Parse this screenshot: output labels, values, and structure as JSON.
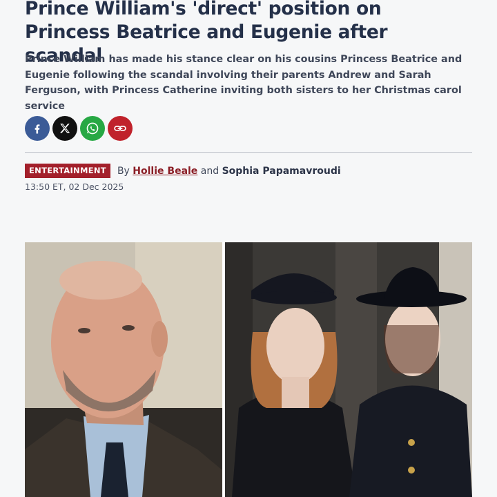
{
  "article": {
    "headline": "Prince William's 'direct' position on Princess Beatrice and Eugenie after scandal",
    "standfirst": "Prince William has made his stance clear on his cousins Princess Beatrice and Eugenie following the scandal involving their parents Andrew and Sarah Ferguson, with Princess Catherine inviting both sisters to her Christmas carol service",
    "category": "ENTERTAINMENT",
    "byline_prefix": "By",
    "author_1": "Hollie Beale",
    "byline_joiner": "and",
    "author_2": "Sophia Papamavroudi",
    "timestamp": "13:50 ET, 02 Dec 2025"
  },
  "share": {
    "buttons": [
      {
        "name": "facebook",
        "icon": "facebook-icon",
        "color": "#3b5b97"
      },
      {
        "name": "x",
        "icon": "x-icon",
        "color": "#111111"
      },
      {
        "name": "whatsapp",
        "icon": "whatsapp-icon",
        "color": "#27a844"
      },
      {
        "name": "copy-link",
        "icon": "link-icon",
        "color": "#c0222b"
      }
    ]
  },
  "colors": {
    "background": "#f6f7f8",
    "headline": "#243049",
    "category_badge": "#a3202b",
    "author_link": "#8b1e26"
  }
}
